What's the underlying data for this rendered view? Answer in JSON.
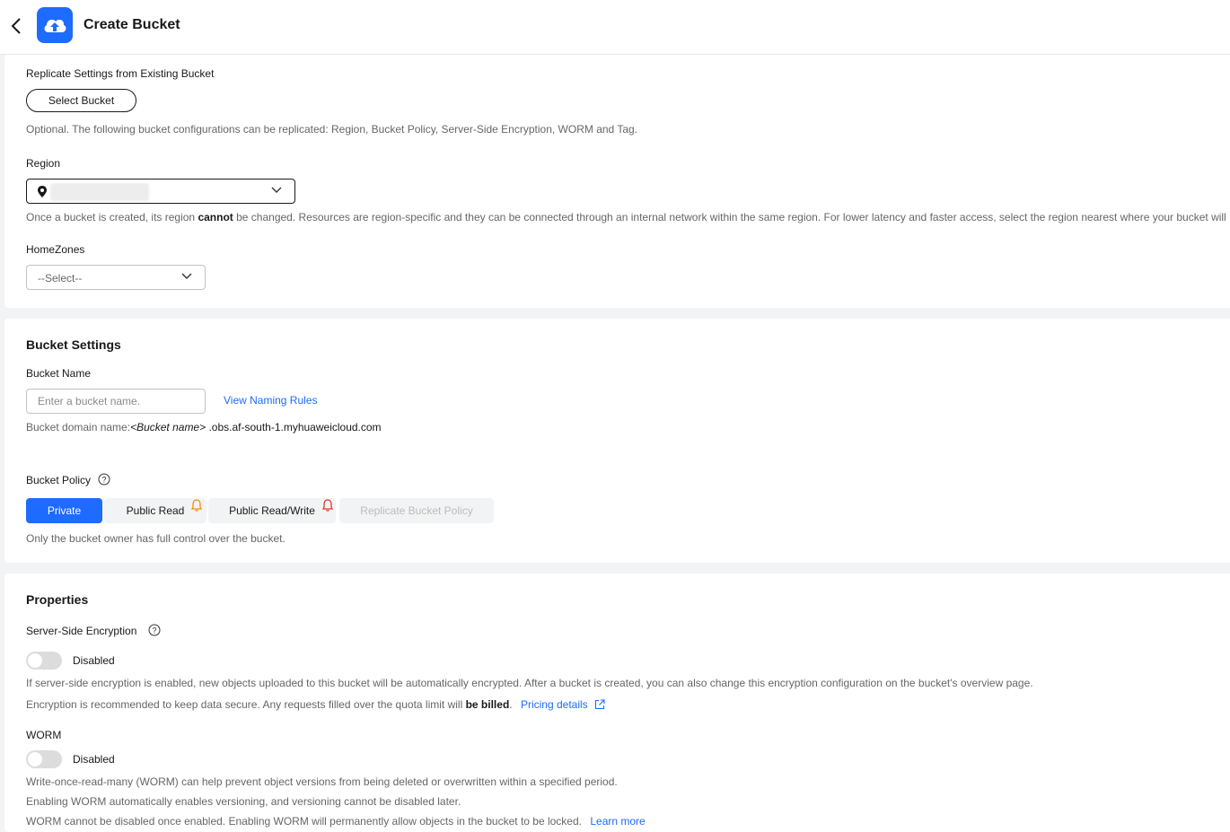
{
  "header": {
    "title": "Create Bucket"
  },
  "replicate": {
    "label": "Replicate Settings from Existing Bucket",
    "button": "Select Bucket",
    "hint": "Optional. The following bucket configurations can be replicated: Region, Bucket Policy, Server-Side Encryption, WORM and Tag."
  },
  "region": {
    "label": "Region",
    "hint_before": "Once a bucket is created, its region ",
    "hint_bold": "cannot",
    "hint_after": " be changed. Resources are region-specific and they can be connected through an internal network within the same region. For lower latency and faster access, select the region nearest where your bucket will"
  },
  "homezones": {
    "label": "HomeZones",
    "value": "--Select--"
  },
  "bucket_settings": {
    "title": "Bucket Settings",
    "name_label": "Bucket Name",
    "name_placeholder": "Enter a bucket name.",
    "naming_rules": "View Naming Rules",
    "domain_prefix": "Bucket domain name:",
    "domain_var": "<Bucket name>",
    "domain_suffix": " .obs.af-south-1.myhuaweicloud.com",
    "policy_label": "Bucket Policy",
    "policy_options": [
      "Private",
      "Public Read",
      "Public Read/Write",
      "Replicate Bucket Policy"
    ],
    "policy_hint": "Only the bucket owner has full control over the bucket."
  },
  "properties": {
    "title": "Properties",
    "sse": {
      "label": "Server-Side Encryption",
      "status": "Disabled",
      "enabled": false,
      "hint1": "If server-side encryption is enabled, new objects uploaded to this bucket will be automatically encrypted. After a bucket is created, you can also change this encryption configuration on the bucket's overview page.",
      "hint2_before": "Encryption is recommended to keep data secure. Any requests filled over the quota limit will ",
      "hint2_bold": "be billed",
      "hint2_after": ".",
      "pricing_link": "Pricing details"
    },
    "worm": {
      "label": "WORM",
      "status": "Disabled",
      "enabled": false,
      "hint1": "Write-once-read-many (WORM) can help prevent object versions from being deleted or overwritten within a specified period.",
      "hint2": "Enabling WORM automatically enables versioning, and versioning cannot be disabled later.",
      "hint3": "WORM cannot be disabled once enabled. Enabling WORM will permanently allow objects in the bucket to be locked.",
      "learn_more": "Learn more"
    }
  },
  "colors": {
    "accent": "#1e6bff",
    "warning": "#f29100",
    "danger": "#e5352c"
  }
}
